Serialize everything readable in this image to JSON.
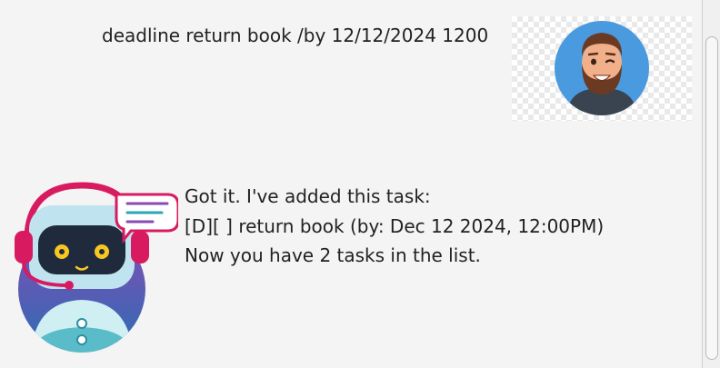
{
  "conversation": {
    "user_message": {
      "text": "deadline return book /by 12/12/2024 1200",
      "avatar_icon": "user-avatar-icon"
    },
    "bot_message": {
      "lines": [
        "Got it. I've added this task:",
        "[D][ ] return book (by: Dec 12 2024, 12:00PM)",
        "Now you have 2 tasks in the list."
      ],
      "avatar_icon": "robot-avatar-icon"
    }
  },
  "colors": {
    "background": "#f4f4f4",
    "user_avatar_bg": "#4a9ae0",
    "bot_headset": "#d81b60"
  }
}
